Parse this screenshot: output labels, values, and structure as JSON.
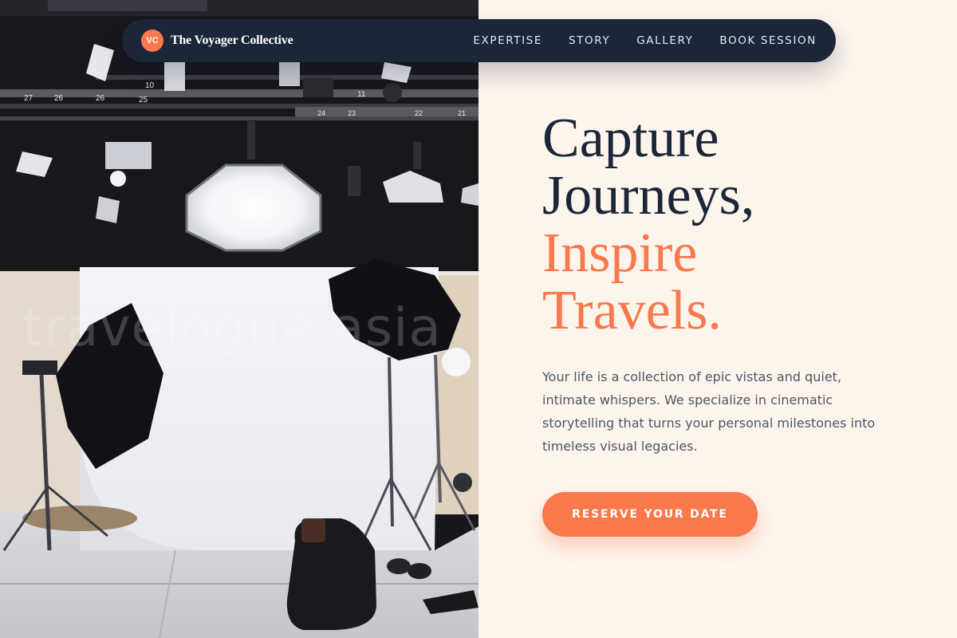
{
  "brand": {
    "initials": "VC",
    "name": "The Voyager Collective"
  },
  "nav": {
    "links": [
      "EXPERTISE",
      "STORY",
      "GALLERY",
      "BOOK SESSION"
    ]
  },
  "hero": {
    "headline_dark": [
      "Capture",
      "Journeys,"
    ],
    "headline_accent": [
      "Inspire",
      "Travels."
    ],
    "body": "Your life is a collection of epic vistas and quiet, intimate whispers. We specialize in cinematic storytelling that turns your personal milestones into timeless visual legacies.",
    "cta_label": "RESERVE YOUR DATE"
  },
  "photo": {
    "watermark": "travelogue.asia",
    "rail_numbers": [
      "27",
      "26",
      "26",
      "25",
      "10",
      "11",
      "24",
      "23",
      "22",
      "21"
    ]
  },
  "colors": {
    "navy": "#1b2638",
    "accent": "#f9784c",
    "background": "#fdf4ec",
    "body_text": "#4d5667"
  },
  "icons": {
    "brand_badge": "brand-badge-icon"
  }
}
